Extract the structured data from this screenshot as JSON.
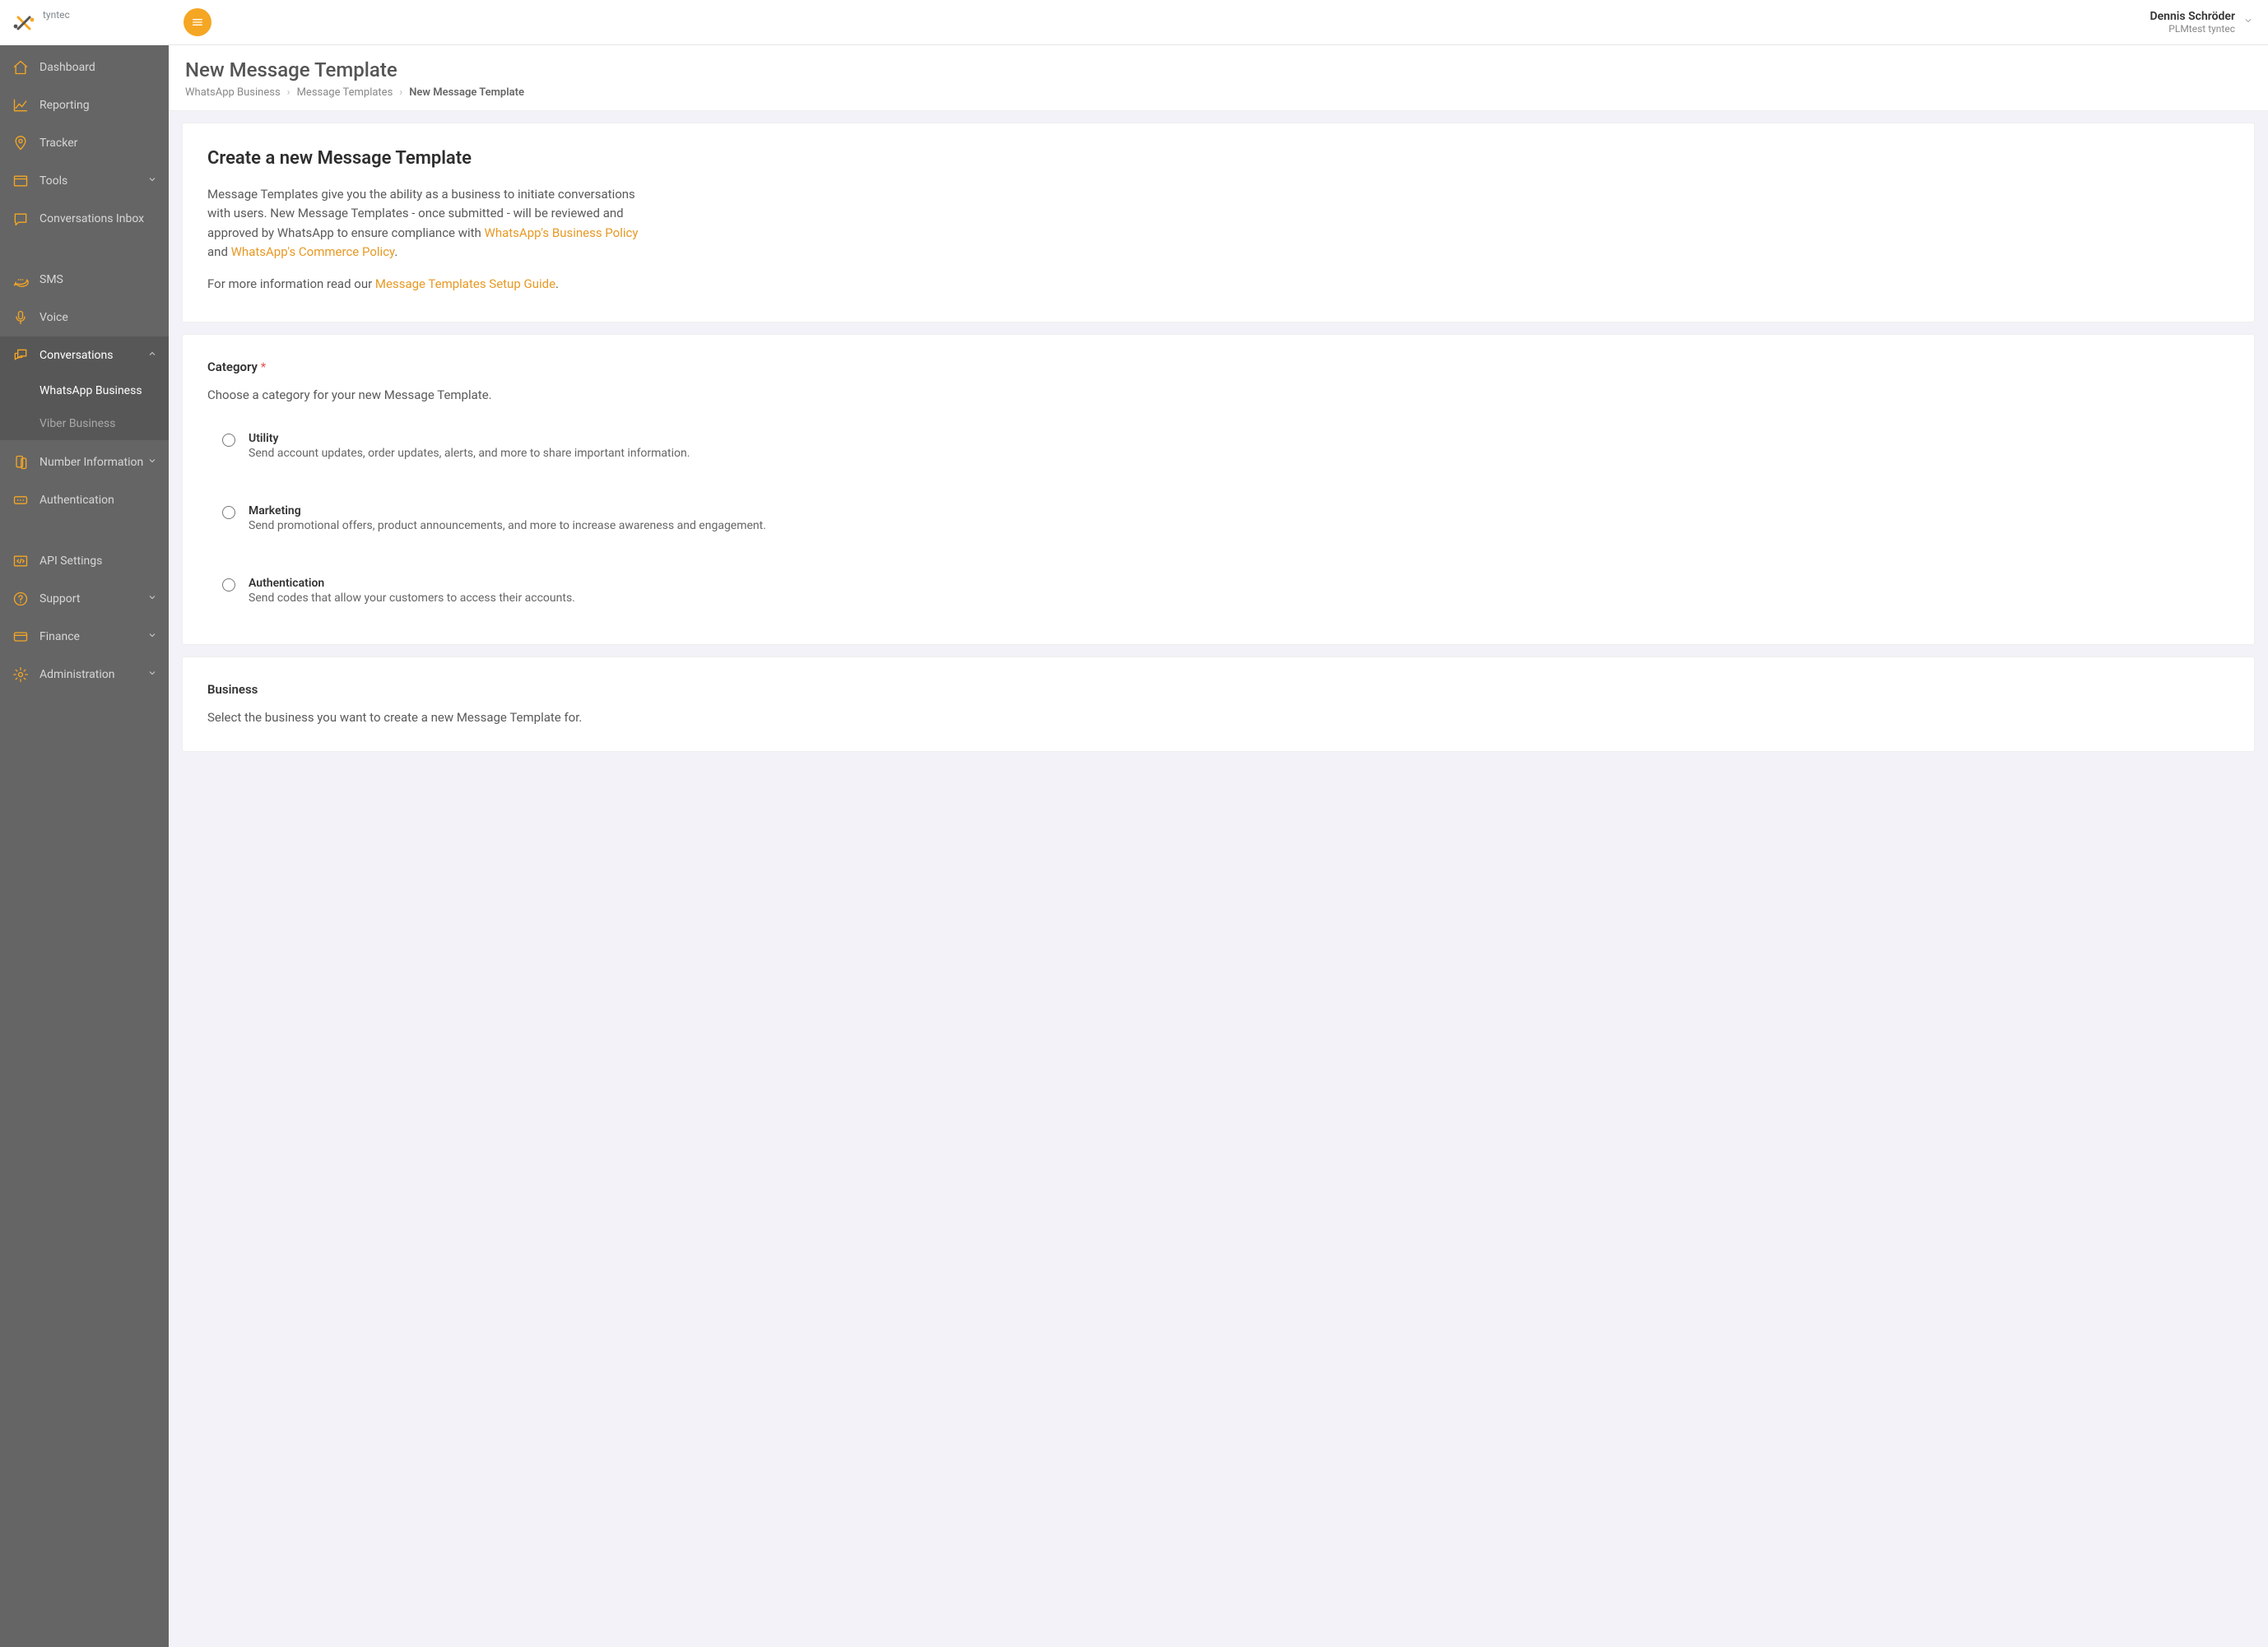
{
  "brand": {
    "name": "tyntec"
  },
  "user": {
    "name": "Dennis Schröder",
    "tenant": "PLMtest tyntec"
  },
  "sidebar": {
    "items": [
      {
        "label": "Dashboard"
      },
      {
        "label": "Reporting"
      },
      {
        "label": "Tracker"
      },
      {
        "label": "Tools"
      },
      {
        "label": "Conversations Inbox"
      },
      {
        "label": "SMS"
      },
      {
        "label": "Voice"
      },
      {
        "label": "Conversations"
      },
      {
        "label": "Number Information"
      },
      {
        "label": "Authentication"
      },
      {
        "label": "API Settings"
      },
      {
        "label": "Support"
      },
      {
        "label": "Finance"
      },
      {
        "label": "Administration"
      }
    ],
    "conversations_sub": [
      {
        "label": "WhatsApp Business"
      },
      {
        "label": "Viber Business"
      }
    ]
  },
  "header": {
    "title": "New Message Template",
    "breadcrumb": [
      "WhatsApp Business",
      "Message Templates",
      "New Message Template"
    ]
  },
  "intro": {
    "heading": "Create a new Message Template",
    "p1_a": "Message Templates give you the ability as a business to initiate conversations with users. New Message Templates - once submitted - will be reviewed and approved by WhatsApp to ensure compliance with ",
    "link1": "WhatsApp's Business Policy",
    "p1_b": " and ",
    "link2": "WhatsApp's Commerce Policy",
    "p1_c": ".",
    "p2_a": "For more information read our ",
    "link3": "Message Templates Setup Guide",
    "p2_b": "."
  },
  "category": {
    "title": "Category",
    "hint": "Choose a category for your new Message Template.",
    "options": [
      {
        "label": "Utility",
        "desc": "Send account updates, order updates, alerts, and more to share important information."
      },
      {
        "label": "Marketing",
        "desc": "Send promotional offers, product announcements, and more to increase awareness and engagement."
      },
      {
        "label": "Authentication",
        "desc": "Send codes that allow your customers to access their accounts."
      }
    ]
  },
  "business": {
    "title": "Business",
    "hint": "Select the business you want to create a new Message Template for."
  }
}
